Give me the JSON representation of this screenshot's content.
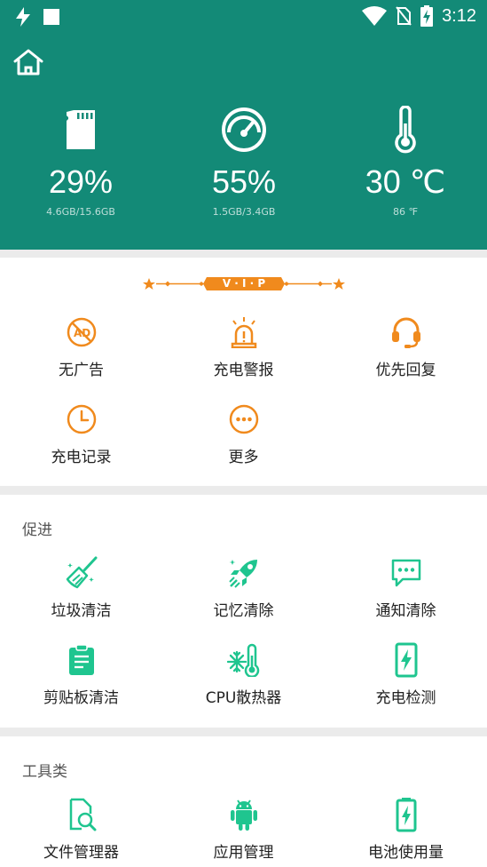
{
  "status_bar": {
    "time": "3:12",
    "icons": [
      "flash-icon",
      "square-notification-icon",
      "wifi-icon",
      "no-sim-icon",
      "battery-charging-icon"
    ]
  },
  "header": {
    "home_icon": "home-icon",
    "stats": [
      {
        "icon": "sd-card-icon",
        "value": "29%",
        "detail": "4.6GB/15.6GB"
      },
      {
        "icon": "speedometer-icon",
        "value": "55%",
        "detail": "1.5GB/3.4GB"
      },
      {
        "icon": "thermometer-icon",
        "value": "30 ℃",
        "detail": "86 ℉"
      }
    ]
  },
  "vip": {
    "badge": "V · I · P",
    "items": [
      {
        "label": "无广告",
        "icon": "no-ads-icon"
      },
      {
        "label": "充电警报",
        "icon": "alarm-light-icon"
      },
      {
        "label": "优先回复",
        "icon": "headset-icon"
      },
      {
        "label": "充电记录",
        "icon": "clock-icon"
      },
      {
        "label": "更多",
        "icon": "more-icon"
      }
    ]
  },
  "promo": {
    "title": "促进",
    "items": [
      {
        "label": "垃圾清洁",
        "icon": "broom-icon"
      },
      {
        "label": "记忆清除",
        "icon": "rocket-icon"
      },
      {
        "label": "通知清除",
        "icon": "message-icon"
      },
      {
        "label": "剪贴板清洁",
        "icon": "clipboard-icon"
      },
      {
        "label": "CPU散热器",
        "icon": "cpu-cooler-icon"
      },
      {
        "label": "充电检测",
        "icon": "charge-detect-icon"
      }
    ]
  },
  "tools": {
    "title": "工具类",
    "items": [
      {
        "label": "文件管理器",
        "icon": "file-search-icon"
      },
      {
        "label": "应用管理",
        "icon": "android-icon"
      },
      {
        "label": "电池使用量",
        "icon": "battery-usage-icon"
      }
    ]
  },
  "colors": {
    "primary": "#138a77",
    "vip_orange": "#f08a1d",
    "tool_green": "#1fc58f"
  }
}
